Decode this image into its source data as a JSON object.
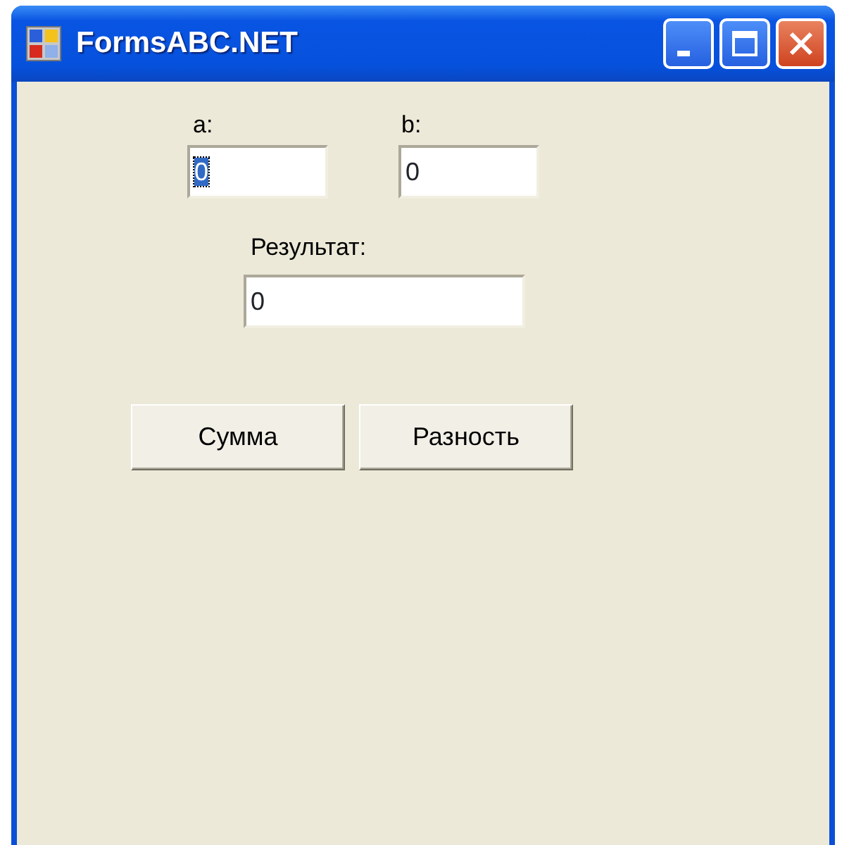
{
  "window": {
    "title": "FormsABC.NET"
  },
  "fields": [
    {
      "label": "a:",
      "value": "0",
      "text_selected": true
    },
    {
      "label": "b:",
      "value": "0",
      "text_selected": false
    },
    {
      "label": "Результат:",
      "value": "0",
      "text_selected": false
    }
  ],
  "buttons": [
    "Сумма",
    "Разность"
  ]
}
